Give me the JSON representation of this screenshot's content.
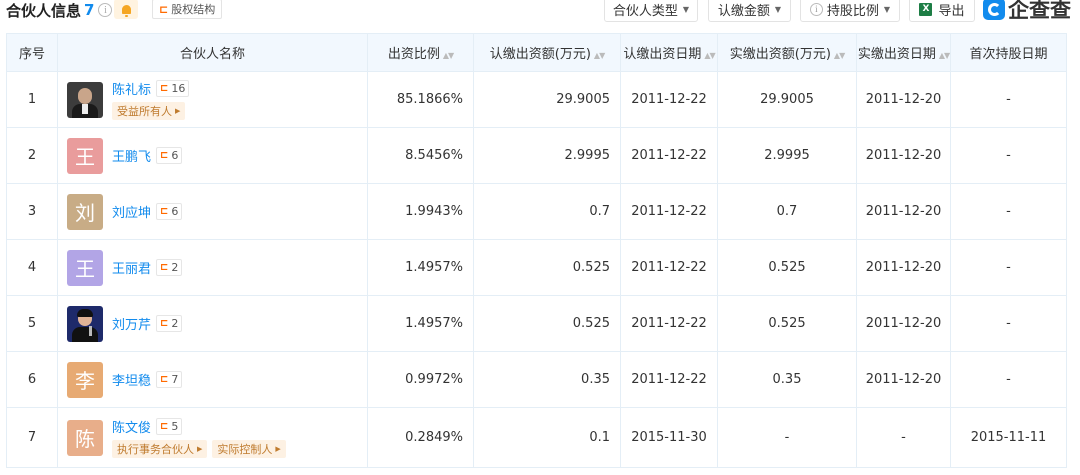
{
  "header": {
    "title": "合伙人信息",
    "count": "7",
    "info_glyph": "i",
    "equity_link": "股权结构",
    "filters": [
      {
        "label": "合伙人类型"
      },
      {
        "label": "认缴金额"
      },
      {
        "label": "持股比例"
      }
    ],
    "export_label": "导出",
    "brand": "企查查"
  },
  "table": {
    "columns": [
      "序号",
      "合伙人名称",
      "出资比例",
      "认缴出资额(万元)",
      "认缴出资日期",
      "实缴出资额(万元)",
      "实缴出资日期",
      "首次持股日期"
    ],
    "rows": [
      {
        "no": "1",
        "name": "陈礼标",
        "avatar": "",
        "avatar_type": "photo-man",
        "relations": "16",
        "tags": [
          "受益所有人"
        ],
        "ratio": "85.1866%",
        "subscribed": "29.9005",
        "sub_date": "2011-12-22",
        "paid": "29.9005",
        "paid_date": "2011-12-20",
        "first_date": "-"
      },
      {
        "no": "2",
        "name": "王鹏飞",
        "avatar": "王",
        "avatar_color": "#e99c9c",
        "relations": "6",
        "tags": [],
        "ratio": "8.5456%",
        "subscribed": "2.9995",
        "sub_date": "2011-12-22",
        "paid": "2.9995",
        "paid_date": "2011-12-20",
        "first_date": "-"
      },
      {
        "no": "3",
        "name": "刘应坤",
        "avatar": "刘",
        "avatar_color": "#c8ac86",
        "relations": "6",
        "tags": [],
        "ratio": "1.9943%",
        "subscribed": "0.7",
        "sub_date": "2011-12-22",
        "paid": "0.7",
        "paid_date": "2011-12-20",
        "first_date": "-"
      },
      {
        "no": "4",
        "name": "王丽君",
        "avatar": "王",
        "avatar_color": "#b2a5e6",
        "relations": "2",
        "tags": [],
        "ratio": "1.4957%",
        "subscribed": "0.525",
        "sub_date": "2011-12-22",
        "paid": "0.525",
        "paid_date": "2011-12-20",
        "first_date": "-"
      },
      {
        "no": "5",
        "name": "刘万芹",
        "avatar": "",
        "avatar_type": "photo-woman",
        "relations": "2",
        "tags": [],
        "ratio": "1.4957%",
        "subscribed": "0.525",
        "sub_date": "2011-12-22",
        "paid": "0.525",
        "paid_date": "2011-12-20",
        "first_date": "-"
      },
      {
        "no": "6",
        "name": "李坦稳",
        "avatar": "李",
        "avatar_color": "#e7aa73",
        "relations": "7",
        "tags": [],
        "ratio": "0.9972%",
        "subscribed": "0.35",
        "sub_date": "2011-12-22",
        "paid": "0.35",
        "paid_date": "2011-12-20",
        "first_date": "-"
      },
      {
        "no": "7",
        "name": "陈文俊",
        "avatar": "陈",
        "avatar_color": "#e8ae8a",
        "relations": "5",
        "tags": [
          "执行事务合伙人",
          "实际控制人"
        ],
        "ratio": "0.2849%",
        "subscribed": "0.1",
        "sub_date": "2015-11-30",
        "paid": "-",
        "paid_date": "-",
        "first_date": "2015-11-11"
      }
    ]
  }
}
